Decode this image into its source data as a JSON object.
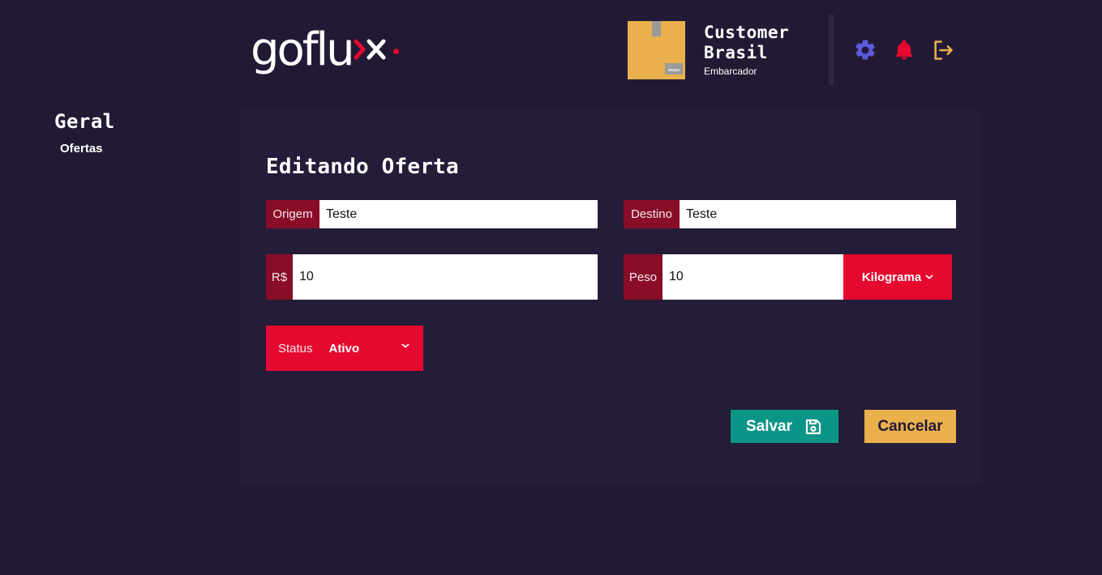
{
  "brand": {
    "logo_main": "goflu",
    "logo_x": "x",
    "colors": {
      "accent": "#e5092f",
      "background": "#221a35",
      "panel": "#241c38",
      "save": "#0b9587",
      "cancel": "#e9b04c",
      "gear": "#5b5bdc"
    }
  },
  "header": {
    "user_name": "Customer Brasil",
    "user_role": "Embarcador",
    "avatar_icon": "package-box-icon",
    "icons": [
      "gear-icon",
      "bell-icon",
      "logout-icon"
    ]
  },
  "sidebar": {
    "section_title": "Geral",
    "items": [
      {
        "label": "Ofertas"
      }
    ]
  },
  "form": {
    "title": "Editando Oferta",
    "origem": {
      "prefix": "Origem",
      "value": "Teste"
    },
    "destino": {
      "prefix": "Destino",
      "value": "Teste"
    },
    "preco": {
      "prefix": "R$",
      "value": "10"
    },
    "peso": {
      "prefix": "Peso",
      "value": "10",
      "unit": "Kilograma"
    },
    "status": {
      "label": "Status",
      "value": "Ativo"
    },
    "save_label": "Salvar",
    "cancel_label": "Cancelar"
  }
}
